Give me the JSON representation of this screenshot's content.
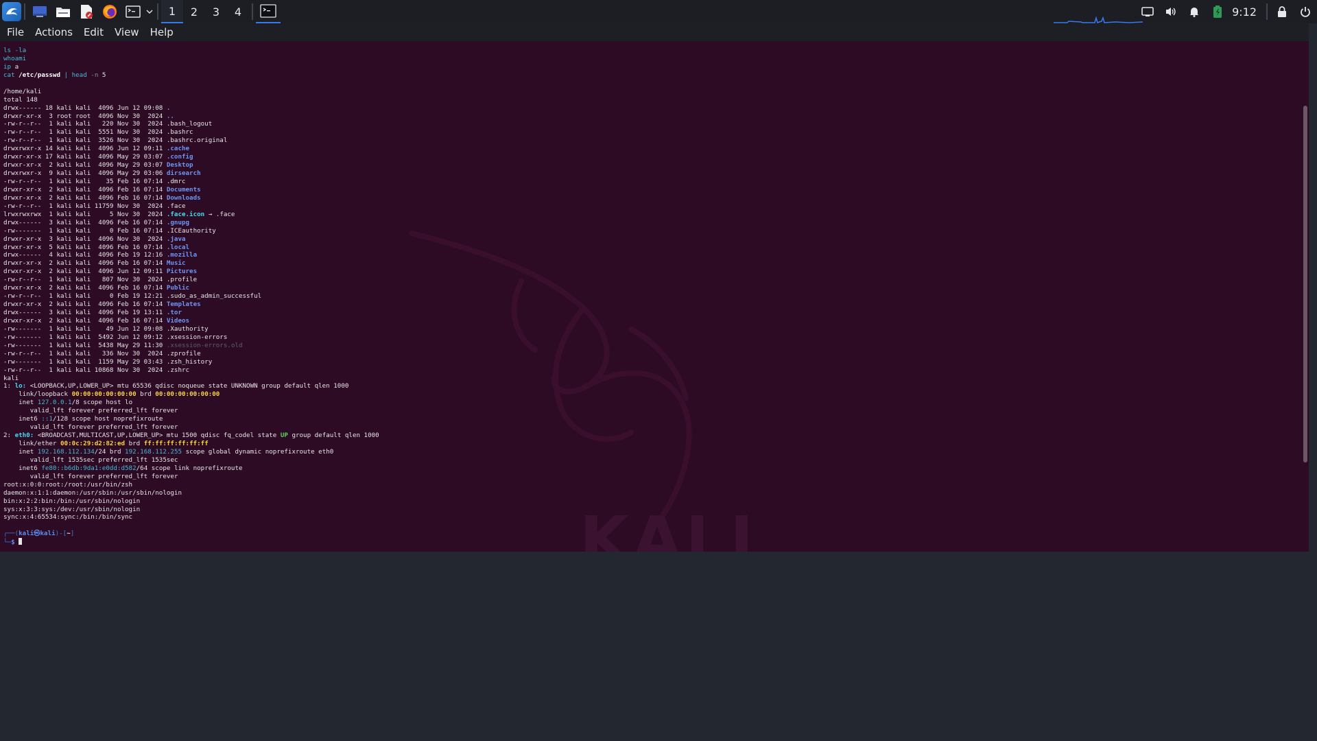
{
  "panel": {
    "workspaces": [
      "1",
      "2",
      "3",
      "4"
    ],
    "active_workspace_index": 0,
    "clock": "9:12",
    "launchers": [
      "kali-menu-icon",
      "desktop-icon",
      "file-manager-icon",
      "text-editor-icon",
      "firefox-icon",
      "terminal-icon"
    ],
    "tray_icons": [
      "screen-icon",
      "volume-icon",
      "notification-bell-icon",
      "battery-icon"
    ],
    "right_icons": [
      "lock-icon",
      "power-icon"
    ]
  },
  "menu": {
    "items": [
      "File",
      "Actions",
      "Edit",
      "View",
      "Help"
    ]
  },
  "terminal": {
    "watermark": "KALI",
    "prompt": {
      "user": "kali",
      "host": "kali",
      "dir": "~",
      "symbol": "$"
    },
    "commands": [
      [
        [
          "ls -la",
          "cmd"
        ]
      ],
      [
        [
          "whoami",
          "cmd"
        ]
      ],
      [
        [
          "ip",
          "cmd"
        ],
        [
          " a",
          "plain"
        ]
      ],
      [
        [
          "cat",
          "cmd"
        ],
        [
          " /etc/passwd",
          "bold"
        ],
        [
          " | ",
          "cmd"
        ],
        [
          "head",
          "cmd"
        ],
        [
          " -n ",
          "dim"
        ],
        [
          "5",
          "plain"
        ]
      ]
    ],
    "output": [
      [
        [
          "",
          ""
        ]
      ],
      [
        [
          "/home/kali",
          ""
        ]
      ],
      [
        [
          "total 148",
          ""
        ]
      ],
      [
        [
          "drwx------ 18 kali kali  4096 Jun 12 09:08 ",
          ""
        ],
        [
          ".",
          "dir"
        ]
      ],
      [
        [
          "drwxr-xr-x  3 root root  4096 Nov 30  2024 ",
          ""
        ],
        [
          "..",
          "dir"
        ]
      ],
      [
        [
          "-rw-r--r--  1 kali kali   220 Nov 30  2024 .bash_logout",
          ""
        ]
      ],
      [
        [
          "-rw-r--r--  1 kali kali  5551 Nov 30  2024 .bashrc",
          ""
        ]
      ],
      [
        [
          "-rw-r--r--  1 kali kali  3526 Nov 30  2024 .bashrc.original",
          ""
        ]
      ],
      [
        [
          "drwxrwxr-x 14 kali kali  4096 Jun 12 09:11 ",
          ""
        ],
        [
          ".cache",
          "dir"
        ]
      ],
      [
        [
          "drwxr-xr-x 17 kali kali  4096 May 29 03:07 ",
          ""
        ],
        [
          ".config",
          "dir"
        ]
      ],
      [
        [
          "drwxr-xr-x  2 kali kali  4096 May 29 03:07 ",
          ""
        ],
        [
          "Desktop",
          "dir"
        ]
      ],
      [
        [
          "drwxrwxr-x  9 kali kali  4096 May 29 03:06 ",
          ""
        ],
        [
          "dirsearch",
          "dir"
        ]
      ],
      [
        [
          "-rw-r--r--  1 kali kali    35 Feb 16 07:14 .dmrc",
          ""
        ]
      ],
      [
        [
          "drwxr-xr-x  2 kali kali  4096 Feb 16 07:14 ",
          ""
        ],
        [
          "Documents",
          "dir"
        ]
      ],
      [
        [
          "drwxr-xr-x  2 kali kali  4096 Feb 16 07:14 ",
          ""
        ],
        [
          "Downloads",
          "dir"
        ]
      ],
      [
        [
          "-rw-r--r--  1 kali kali 11759 Nov 30  2024 .face",
          ""
        ]
      ],
      [
        [
          "lrwxrwxrwx  1 kali kali     5 Nov 30  2024 ",
          ""
        ],
        [
          ".face.icon",
          "link"
        ],
        [
          " → .face",
          ""
        ]
      ],
      [
        [
          "drwx------  3 kali kali  4096 Feb 16 07:14 ",
          ""
        ],
        [
          ".gnupg",
          "dir"
        ]
      ],
      [
        [
          "-rw-------  1 kali kali     0 Feb 16 07:14 .ICEauthority",
          ""
        ]
      ],
      [
        [
          "drwxr-xr-x  3 kali kali  4096 Nov 30  2024 ",
          ""
        ],
        [
          ".java",
          "dir"
        ]
      ],
      [
        [
          "drwxr-xr-x  5 kali kali  4096 Feb 16 07:14 ",
          ""
        ],
        [
          ".local",
          "dir"
        ]
      ],
      [
        [
          "drwx------  4 kali kali  4096 Feb 19 12:16 ",
          ""
        ],
        [
          ".mozilla",
          "dir"
        ]
      ],
      [
        [
          "drwxr-xr-x  2 kali kali  4096 Feb 16 07:14 ",
          ""
        ],
        [
          "Music",
          "dir"
        ]
      ],
      [
        [
          "drwxr-xr-x  2 kali kali  4096 Jun 12 09:11 ",
          ""
        ],
        [
          "Pictures",
          "dir"
        ]
      ],
      [
        [
          "-rw-r--r--  1 kali kali   807 Nov 30  2024 .profile",
          ""
        ]
      ],
      [
        [
          "drwxr-xr-x  2 kali kali  4096 Feb 16 07:14 ",
          ""
        ],
        [
          "Public",
          "dir"
        ]
      ],
      [
        [
          "-rw-r--r--  1 kali kali     0 Feb 19 12:21 .sudo_as_admin_successful",
          ""
        ]
      ],
      [
        [
          "drwxr-xr-x  2 kali kali  4096 Feb 16 07:14 ",
          ""
        ],
        [
          "Templates",
          "dir"
        ]
      ],
      [
        [
          "drwx------  3 kali kali  4096 Feb 19 13:11 ",
          ""
        ],
        [
          ".tor",
          "dir"
        ]
      ],
      [
        [
          "drwxr-xr-x  2 kali kali  4096 Feb 16 07:14 ",
          ""
        ],
        [
          "Videos",
          "dir"
        ]
      ],
      [
        [
          "-rw-------  1 kali kali    49 Jun 12 09:08 .Xauthority",
          ""
        ]
      ],
      [
        [
          "-rw-------  1 kali kali  5492 Jun 12 09:12 .xsession-errors",
          ""
        ]
      ],
      [
        [
          "-rw-------  1 kali kali  5438 May 29 11:30 ",
          ""
        ],
        [
          ".xsession-errors.old",
          "ghost"
        ]
      ],
      [
        [
          "-rw-r--r--  1 kali kali   336 Nov 30  2024 .zprofile",
          ""
        ]
      ],
      [
        [
          "-rw-------  1 kali kali  1159 May 29 03:43 .zsh_history",
          ""
        ]
      ],
      [
        [
          "-rw-r--r--  1 kali kali 10868 Nov 30  2024 .zshrc",
          ""
        ]
      ],
      [
        [
          "kali",
          ""
        ]
      ],
      [
        [
          "1: ",
          ""
        ],
        [
          "lo:",
          "iface"
        ],
        [
          " <LOOPBACK,UP,LOWER_UP> mtu 65536 qdisc noqueue state UNKNOWN group default qlen 1000",
          ""
        ]
      ],
      [
        [
          "    link/loopback ",
          ""
        ],
        [
          "00:00:00:00:00:00",
          "mac"
        ],
        [
          " brd ",
          ""
        ],
        [
          "00:00:00:00:00:00",
          "mac"
        ]
      ],
      [
        [
          "    inet ",
          ""
        ],
        [
          "127.0.0.1",
          "v6"
        ],
        [
          "/8 scope host lo",
          ""
        ]
      ],
      [
        [
          "       valid_lft forever preferred_lft forever",
          ""
        ]
      ],
      [
        [
          "    inet6 ",
          ""
        ],
        [
          "::1",
          "v6"
        ],
        [
          "/128 scope host noprefixroute",
          ""
        ]
      ],
      [
        [
          "       valid_lft forever preferred_lft forever",
          ""
        ]
      ],
      [
        [
          "2: ",
          ""
        ],
        [
          "eth0:",
          "iface"
        ],
        [
          " <BROADCAST,MULTICAST,UP,LOWER_UP> mtu 1500 qdisc fq_codel state ",
          ""
        ],
        [
          "UP",
          "up"
        ],
        [
          " group default qlen 1000",
          ""
        ]
      ],
      [
        [
          "    link/ether ",
          ""
        ],
        [
          "00:0c:29:d2:82:ed",
          "mac"
        ],
        [
          " brd ",
          ""
        ],
        [
          "ff:ff:ff:ff:ff:ff",
          "mac"
        ]
      ],
      [
        [
          "    inet ",
          ""
        ],
        [
          "192.168.112.134",
          "v6"
        ],
        [
          "/24 brd ",
          ""
        ],
        [
          "192.168.112.255",
          "v6"
        ],
        [
          " scope global dynamic noprefixroute eth0",
          ""
        ]
      ],
      [
        [
          "       valid_lft 1535sec preferred_lft 1535sec",
          ""
        ]
      ],
      [
        [
          "    inet6 ",
          ""
        ],
        [
          "fe80::b6db:9da1:e0dd:d582",
          "v6"
        ],
        [
          "/64 scope link noprefixroute",
          ""
        ]
      ],
      [
        [
          "       valid_lft forever preferred_lft forever",
          ""
        ]
      ],
      [
        [
          "root:x:0:0:root:/root:/usr/bin/zsh",
          ""
        ]
      ],
      [
        [
          "daemon:x:1:1:daemon:/usr/sbin:/usr/sbin/nologin",
          ""
        ]
      ],
      [
        [
          "bin:x:2:2:bin:/bin:/usr/sbin/nologin",
          ""
        ]
      ],
      [
        [
          "sys:x:3:3:sys:/dev:/usr/sbin/nologin",
          ""
        ]
      ],
      [
        [
          "sync:x:4:65534:sync:/bin:/bin/sync",
          ""
        ]
      ],
      [
        [
          "",
          ""
        ]
      ]
    ]
  },
  "colors": {
    "terminal_bg": "#2e0b24",
    "panel_bg": "#1c1e24",
    "accent": "#367bf0",
    "dir": "#6e96f4",
    "mac": "#f5d23e"
  }
}
